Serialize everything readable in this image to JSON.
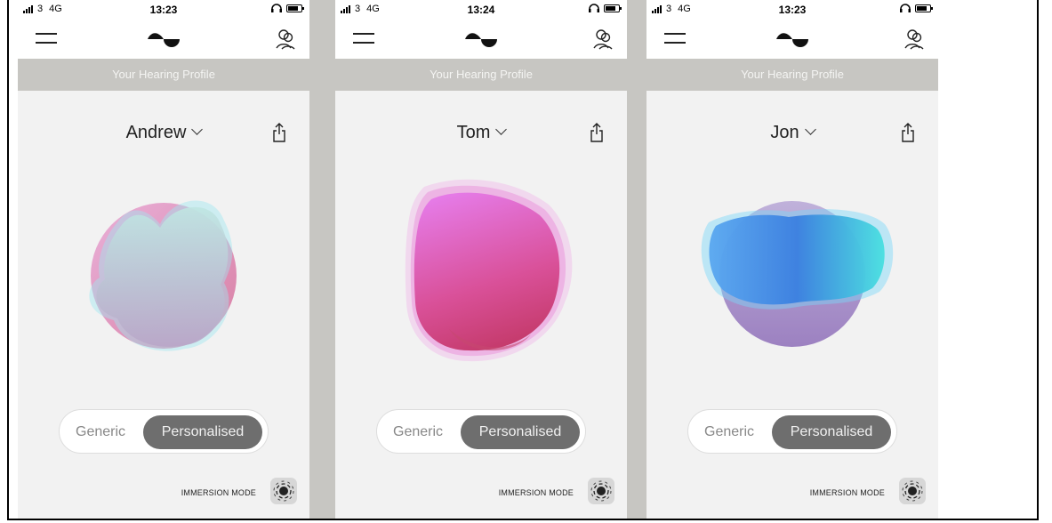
{
  "colors": {
    "divider": "#c7c6c2",
    "toggle_active": "#6e6e6e",
    "screen_bg": "#f2f2f2"
  },
  "screens": [
    {
      "status": {
        "carrier": "3",
        "network": "4G",
        "time": "13:23"
      },
      "banner": "Your Hearing Profile",
      "profile_name": "Andrew",
      "blob_style": "pastel blue-pink",
      "toggle": {
        "generic": "Generic",
        "personalised": "Personalised",
        "selected": "Personalised"
      },
      "immersion_label": "IMMERSION MODE"
    },
    {
      "status": {
        "carrier": "3",
        "network": "4G",
        "time": "13:24"
      },
      "banner": "Your Hearing Profile",
      "profile_name": "Tom",
      "blob_style": "magenta",
      "toggle": {
        "generic": "Generic",
        "personalised": "Personalised",
        "selected": "Personalised"
      },
      "immersion_label": "IMMERSION MODE"
    },
    {
      "status": {
        "carrier": "3",
        "network": "4G",
        "time": "13:23"
      },
      "banner": "Your Hearing Profile",
      "profile_name": "Jon",
      "blob_style": "cyan-blue over purple",
      "toggle": {
        "generic": "Generic",
        "personalised": "Personalised",
        "selected": "Personalised"
      },
      "immersion_label": "IMMERSION MODE"
    }
  ],
  "icons": {
    "menu": "hamburger-menu-icon",
    "logo": "brand-logo",
    "profiles": "user-profiles-icon",
    "share": "share-icon",
    "immersion": "immersion-mode-icon",
    "headphones": "headphones-icon",
    "battery": "battery-icon",
    "signal": "signal-icon"
  }
}
